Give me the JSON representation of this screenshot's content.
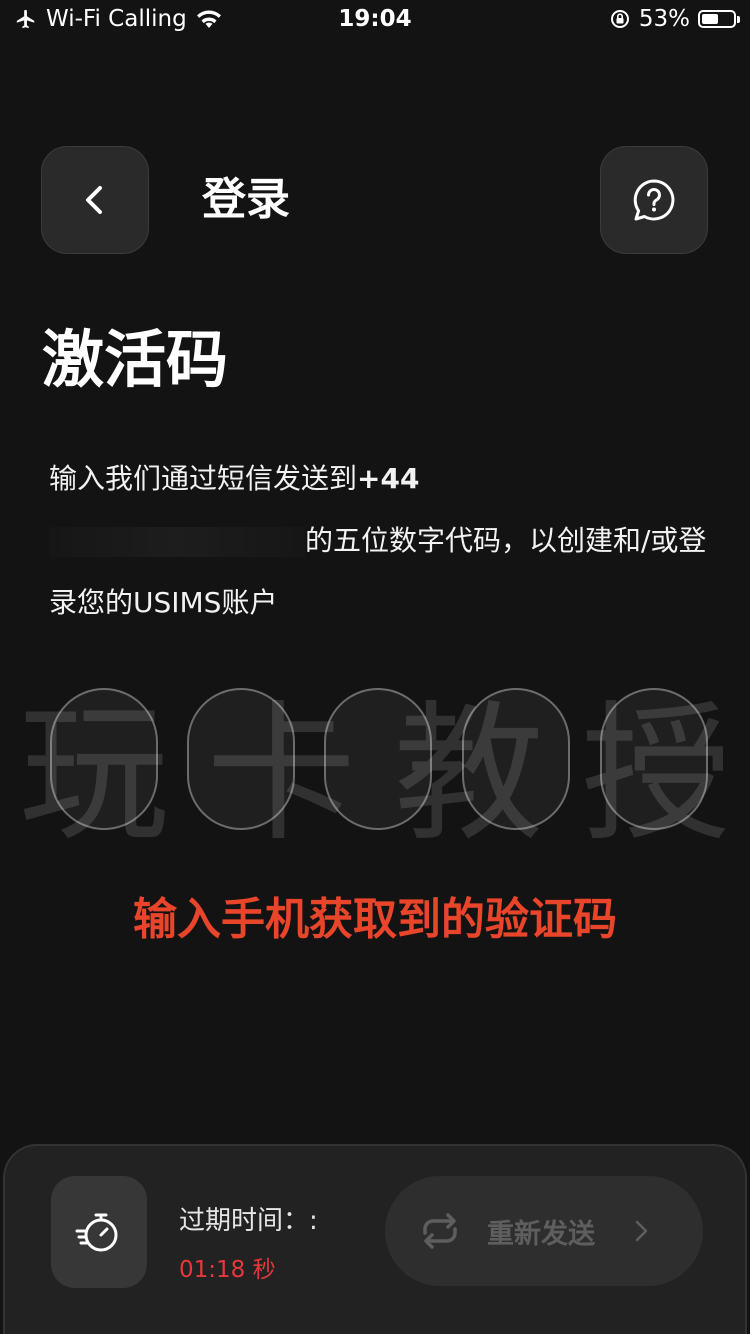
{
  "status_bar": {
    "carrier": "Wi-Fi Calling",
    "time": "19:04",
    "battery_percent": "53%",
    "battery_level": 0.53,
    "icons": [
      "airplane-icon",
      "wifi-icon",
      "orientation-lock-icon",
      "battery-icon"
    ]
  },
  "header": {
    "title": "登录",
    "back_icon": "chevron-left-icon",
    "help_icon": "help-bubble-icon"
  },
  "main": {
    "title": "激活码",
    "description_prefix": "输入我们通过短信发送到",
    "phone_prefix": "+44",
    "description_suffix": "的五位数字代码，以创建和/或登录您的USIMS账户"
  },
  "code_input": {
    "slot_count": 5,
    "values": [
      "",
      "",
      "",
      "",
      ""
    ]
  },
  "watermark": {
    "chars": [
      "玩",
      "卡",
      "教",
      "授"
    ]
  },
  "overlay": {
    "hint": "输入手机获取到的验证码",
    "color": "#e8452a"
  },
  "bottom": {
    "timer_icon": "stopwatch-icon",
    "expiry_label": "过期时间：:",
    "expiry_value": "01:18 秒",
    "resend_label": "重新发送",
    "resend_icon": "refresh-icon",
    "chevron_icon": "chevron-right-icon"
  }
}
